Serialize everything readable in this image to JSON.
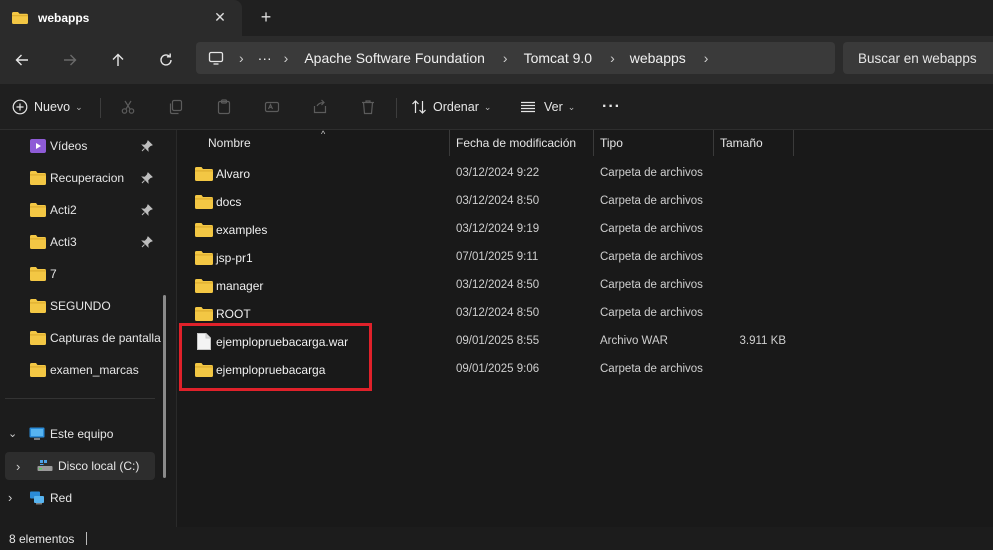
{
  "window": {
    "tab_title": "webapps",
    "close_glyph": "✕",
    "new_tab_glyph": "+"
  },
  "address": {
    "more_glyph": "···",
    "chevron": "›",
    "breadcrumbs": [
      "Apache Software Foundation",
      "Tomcat 9.0",
      "webapps"
    ],
    "search_placeholder": "Buscar en webapps"
  },
  "toolbar": {
    "new_label": "Nuevo",
    "sort_label": "Ordenar",
    "view_label": "Ver",
    "more_glyph": "···",
    "dropdown_glyph": "⌄"
  },
  "sidebar": {
    "items": [
      {
        "label": "Vídeos",
        "icon": "videos-icon",
        "pinned": true
      },
      {
        "label": "Recuperacion",
        "icon": "folder-icon",
        "pinned": true
      },
      {
        "label": "Acti2",
        "icon": "folder-icon",
        "pinned": true
      },
      {
        "label": "Acti3",
        "icon": "folder-icon",
        "pinned": true
      },
      {
        "label": "7",
        "icon": "folder-icon",
        "pinned": false
      },
      {
        "label": "SEGUNDO",
        "icon": "folder-icon",
        "pinned": false
      },
      {
        "label": "Capturas de pantalla",
        "icon": "folder-icon",
        "pinned": false
      },
      {
        "label": "examen_marcas",
        "icon": "folder-icon",
        "pinned": false
      }
    ],
    "this_pc": {
      "label": "Este equipo",
      "icon": "computer-icon",
      "expanded": true
    },
    "local_disk": {
      "label": "Disco local (C:)",
      "icon": "drive-icon",
      "selected": true
    },
    "network": {
      "label": "Red",
      "icon": "network-icon"
    },
    "expander_open": "⌄",
    "expander_closed": "›"
  },
  "columns": {
    "name": "Nombre",
    "modified": "Fecha de modificación",
    "type": "Tipo",
    "size": "Tamaño"
  },
  "files": [
    {
      "name": "Alvaro",
      "modified": "03/12/2024 9:22",
      "type": "Carpeta de archivos",
      "size": "",
      "icon": "folder-icon"
    },
    {
      "name": "docs",
      "modified": "03/12/2024 8:50",
      "type": "Carpeta de archivos",
      "size": "",
      "icon": "folder-icon"
    },
    {
      "name": "examples",
      "modified": "03/12/2024 9:19",
      "type": "Carpeta de archivos",
      "size": "",
      "icon": "folder-icon"
    },
    {
      "name": "jsp-pr1",
      "modified": "07/01/2025 9:11",
      "type": "Carpeta de archivos",
      "size": "",
      "icon": "folder-icon"
    },
    {
      "name": "manager",
      "modified": "03/12/2024 8:50",
      "type": "Carpeta de archivos",
      "size": "",
      "icon": "folder-icon"
    },
    {
      "name": "ROOT",
      "modified": "03/12/2024 8:50",
      "type": "Carpeta de archivos",
      "size": "",
      "icon": "folder-icon"
    },
    {
      "name": "ejemplopruebacarga.war",
      "modified": "09/01/2025 8:55",
      "type": "Archivo WAR",
      "size": "3.911 KB",
      "icon": "file-icon"
    },
    {
      "name": "ejemplopruebacarga",
      "modified": "09/01/2025 9:06",
      "type": "Carpeta de archivos",
      "size": "",
      "icon": "folder-icon"
    }
  ],
  "status": {
    "item_count": "8 elementos"
  },
  "colors": {
    "folder": "#f3c744",
    "highlight": "#e0212a",
    "background": "#191919"
  }
}
